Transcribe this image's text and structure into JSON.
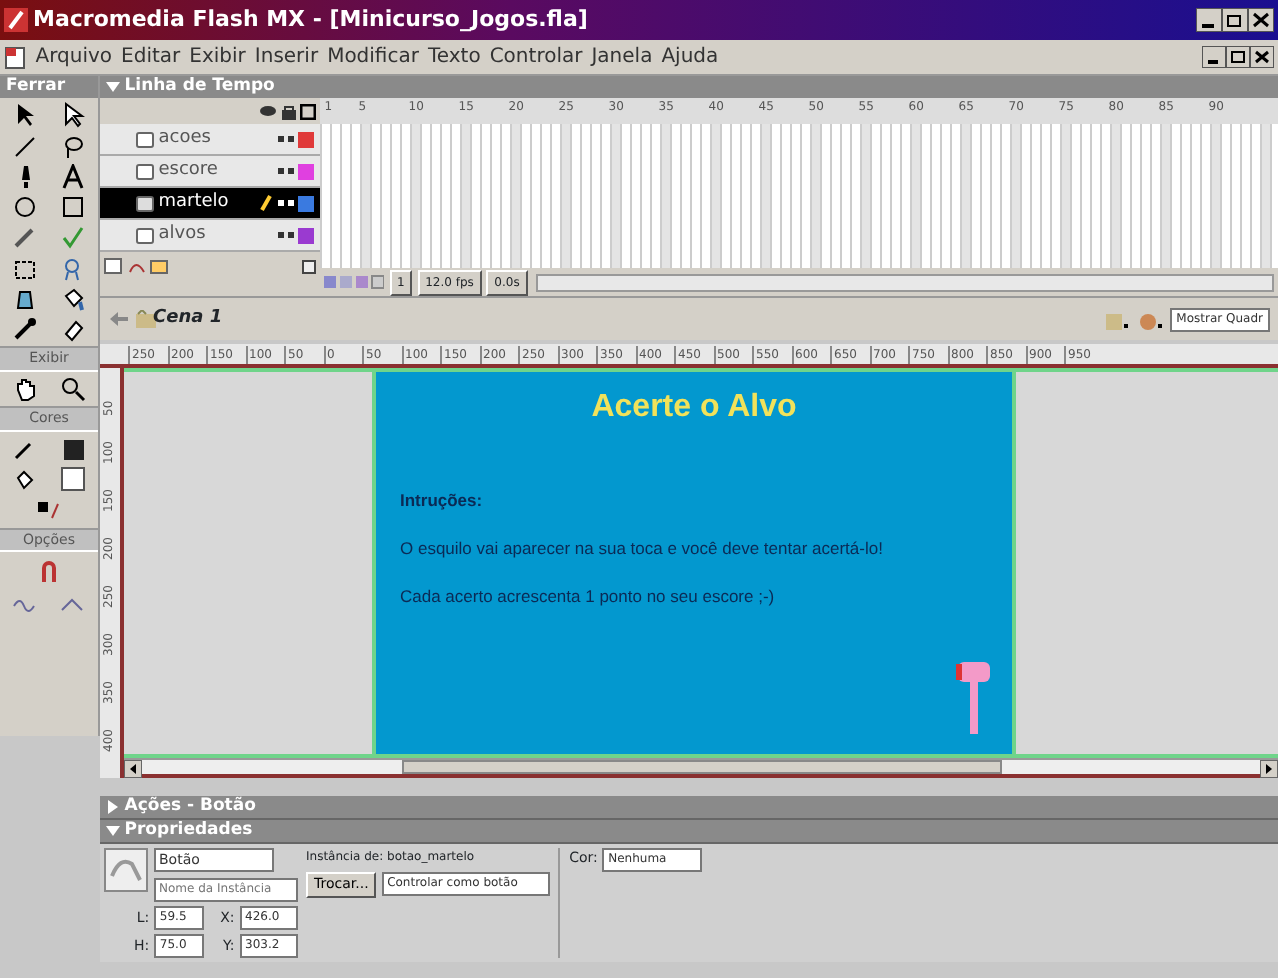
{
  "window": {
    "title": "Macromedia Flash MX - [Minicurso_Jogos.fla]"
  },
  "menu": [
    "Arquivo",
    "Editar",
    "Exibir",
    "Inserir",
    "Modificar",
    "Texto",
    "Controlar",
    "Janela",
    "Ajuda"
  ],
  "tools": {
    "header": "Ferrar",
    "sections": [
      "Exibir",
      "Cores",
      "Opções"
    ]
  },
  "timeline": {
    "title": "Linha de Tempo",
    "frame_numbers": [
      "1",
      "5",
      "10",
      "15",
      "20",
      "25",
      "30",
      "35",
      "40",
      "45",
      "50",
      "55",
      "60",
      "65",
      "70",
      "75",
      "80",
      "85",
      "90"
    ],
    "layers": [
      {
        "name": "acoes",
        "color": "#e03a3a",
        "selected": false,
        "editing": false
      },
      {
        "name": "escore",
        "color": "#e040e0",
        "selected": false,
        "editing": false
      },
      {
        "name": "martelo",
        "color": "#3a7ae0",
        "selected": true,
        "editing": true
      },
      {
        "name": "alvos",
        "color": "#9a3ad0",
        "selected": false,
        "editing": false
      }
    ],
    "current_frame": "1",
    "fps": "12.0 fps",
    "time": "0.0s"
  },
  "scene": {
    "name": "Cena 1",
    "view": "Mostrar Quadr"
  },
  "ruler": {
    "horizontal": [
      "250",
      "200",
      "150",
      "100",
      "50",
      "0",
      "50",
      "100",
      "150",
      "200",
      "250",
      "300",
      "350",
      "400",
      "450",
      "500",
      "550",
      "600",
      "650",
      "700",
      "750",
      "800",
      "850",
      "900",
      "950"
    ],
    "vertical": [
      "50",
      "100",
      "150",
      "200",
      "250",
      "300",
      "350",
      "400"
    ]
  },
  "stage": {
    "title": "Acerte o Alvo",
    "heading": "Intruções:",
    "lines": [
      "O esquilo vai aparecer na sua toca e você deve tentar acertá-lo!",
      "Cada acerto acrescenta 1 ponto no seu escore ;-)"
    ]
  },
  "panels": [
    {
      "title": "Ações - Botão",
      "expanded": false
    },
    {
      "title": "Propriedades",
      "expanded": true
    }
  ],
  "properties": {
    "type": "Botão",
    "instance_placeholder": "Nome da Instância",
    "instance_of": "Instância de: botao_martelo",
    "swap": "Trocar...",
    "track": "Controlar como botão",
    "color_label": "Cor:",
    "color_effect": "Nenhuma",
    "dims": [
      {
        "label": "L:",
        "value": "59.5"
      },
      {
        "label": "X:",
        "value": "426.0"
      },
      {
        "label": "H:",
        "value": "75.0"
      },
      {
        "label": "Y:",
        "value": "303.2"
      }
    ]
  }
}
